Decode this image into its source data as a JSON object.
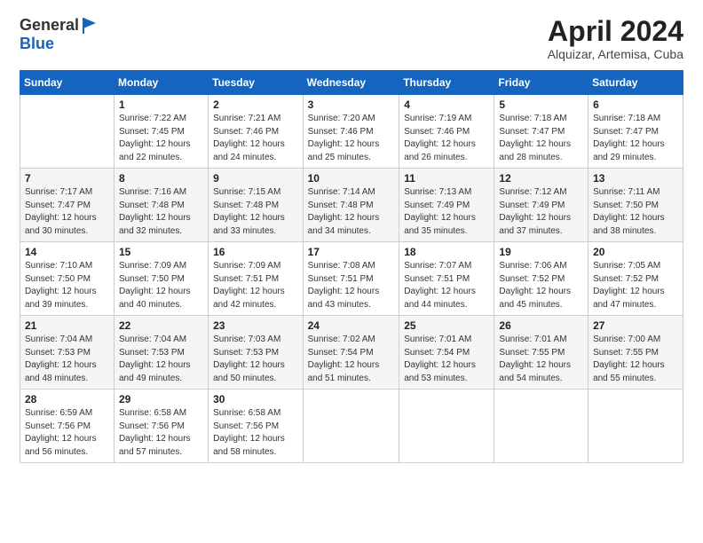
{
  "header": {
    "logo_line1": "General",
    "logo_line2": "Blue",
    "month_title": "April 2024",
    "location": "Alquizar, Artemisa, Cuba"
  },
  "calendar": {
    "days_of_week": [
      "Sunday",
      "Monday",
      "Tuesday",
      "Wednesday",
      "Thursday",
      "Friday",
      "Saturday"
    ],
    "weeks": [
      [
        {
          "day": "",
          "info": ""
        },
        {
          "day": "1",
          "info": "Sunrise: 7:22 AM\nSunset: 7:45 PM\nDaylight: 12 hours\nand 22 minutes."
        },
        {
          "day": "2",
          "info": "Sunrise: 7:21 AM\nSunset: 7:46 PM\nDaylight: 12 hours\nand 24 minutes."
        },
        {
          "day": "3",
          "info": "Sunrise: 7:20 AM\nSunset: 7:46 PM\nDaylight: 12 hours\nand 25 minutes."
        },
        {
          "day": "4",
          "info": "Sunrise: 7:19 AM\nSunset: 7:46 PM\nDaylight: 12 hours\nand 26 minutes."
        },
        {
          "day": "5",
          "info": "Sunrise: 7:18 AM\nSunset: 7:47 PM\nDaylight: 12 hours\nand 28 minutes."
        },
        {
          "day": "6",
          "info": "Sunrise: 7:18 AM\nSunset: 7:47 PM\nDaylight: 12 hours\nand 29 minutes."
        }
      ],
      [
        {
          "day": "7",
          "info": "Sunrise: 7:17 AM\nSunset: 7:47 PM\nDaylight: 12 hours\nand 30 minutes."
        },
        {
          "day": "8",
          "info": "Sunrise: 7:16 AM\nSunset: 7:48 PM\nDaylight: 12 hours\nand 32 minutes."
        },
        {
          "day": "9",
          "info": "Sunrise: 7:15 AM\nSunset: 7:48 PM\nDaylight: 12 hours\nand 33 minutes."
        },
        {
          "day": "10",
          "info": "Sunrise: 7:14 AM\nSunset: 7:48 PM\nDaylight: 12 hours\nand 34 minutes."
        },
        {
          "day": "11",
          "info": "Sunrise: 7:13 AM\nSunset: 7:49 PM\nDaylight: 12 hours\nand 35 minutes."
        },
        {
          "day": "12",
          "info": "Sunrise: 7:12 AM\nSunset: 7:49 PM\nDaylight: 12 hours\nand 37 minutes."
        },
        {
          "day": "13",
          "info": "Sunrise: 7:11 AM\nSunset: 7:50 PM\nDaylight: 12 hours\nand 38 minutes."
        }
      ],
      [
        {
          "day": "14",
          "info": "Sunrise: 7:10 AM\nSunset: 7:50 PM\nDaylight: 12 hours\nand 39 minutes."
        },
        {
          "day": "15",
          "info": "Sunrise: 7:09 AM\nSunset: 7:50 PM\nDaylight: 12 hours\nand 40 minutes."
        },
        {
          "day": "16",
          "info": "Sunrise: 7:09 AM\nSunset: 7:51 PM\nDaylight: 12 hours\nand 42 minutes."
        },
        {
          "day": "17",
          "info": "Sunrise: 7:08 AM\nSunset: 7:51 PM\nDaylight: 12 hours\nand 43 minutes."
        },
        {
          "day": "18",
          "info": "Sunrise: 7:07 AM\nSunset: 7:51 PM\nDaylight: 12 hours\nand 44 minutes."
        },
        {
          "day": "19",
          "info": "Sunrise: 7:06 AM\nSunset: 7:52 PM\nDaylight: 12 hours\nand 45 minutes."
        },
        {
          "day": "20",
          "info": "Sunrise: 7:05 AM\nSunset: 7:52 PM\nDaylight: 12 hours\nand 47 minutes."
        }
      ],
      [
        {
          "day": "21",
          "info": "Sunrise: 7:04 AM\nSunset: 7:53 PM\nDaylight: 12 hours\nand 48 minutes."
        },
        {
          "day": "22",
          "info": "Sunrise: 7:04 AM\nSunset: 7:53 PM\nDaylight: 12 hours\nand 49 minutes."
        },
        {
          "day": "23",
          "info": "Sunrise: 7:03 AM\nSunset: 7:53 PM\nDaylight: 12 hours\nand 50 minutes."
        },
        {
          "day": "24",
          "info": "Sunrise: 7:02 AM\nSunset: 7:54 PM\nDaylight: 12 hours\nand 51 minutes."
        },
        {
          "day": "25",
          "info": "Sunrise: 7:01 AM\nSunset: 7:54 PM\nDaylight: 12 hours\nand 53 minutes."
        },
        {
          "day": "26",
          "info": "Sunrise: 7:01 AM\nSunset: 7:55 PM\nDaylight: 12 hours\nand 54 minutes."
        },
        {
          "day": "27",
          "info": "Sunrise: 7:00 AM\nSunset: 7:55 PM\nDaylight: 12 hours\nand 55 minutes."
        }
      ],
      [
        {
          "day": "28",
          "info": "Sunrise: 6:59 AM\nSunset: 7:56 PM\nDaylight: 12 hours\nand 56 minutes."
        },
        {
          "day": "29",
          "info": "Sunrise: 6:58 AM\nSunset: 7:56 PM\nDaylight: 12 hours\nand 57 minutes."
        },
        {
          "day": "30",
          "info": "Sunrise: 6:58 AM\nSunset: 7:56 PM\nDaylight: 12 hours\nand 58 minutes."
        },
        {
          "day": "",
          "info": ""
        },
        {
          "day": "",
          "info": ""
        },
        {
          "day": "",
          "info": ""
        },
        {
          "day": "",
          "info": ""
        }
      ]
    ]
  }
}
